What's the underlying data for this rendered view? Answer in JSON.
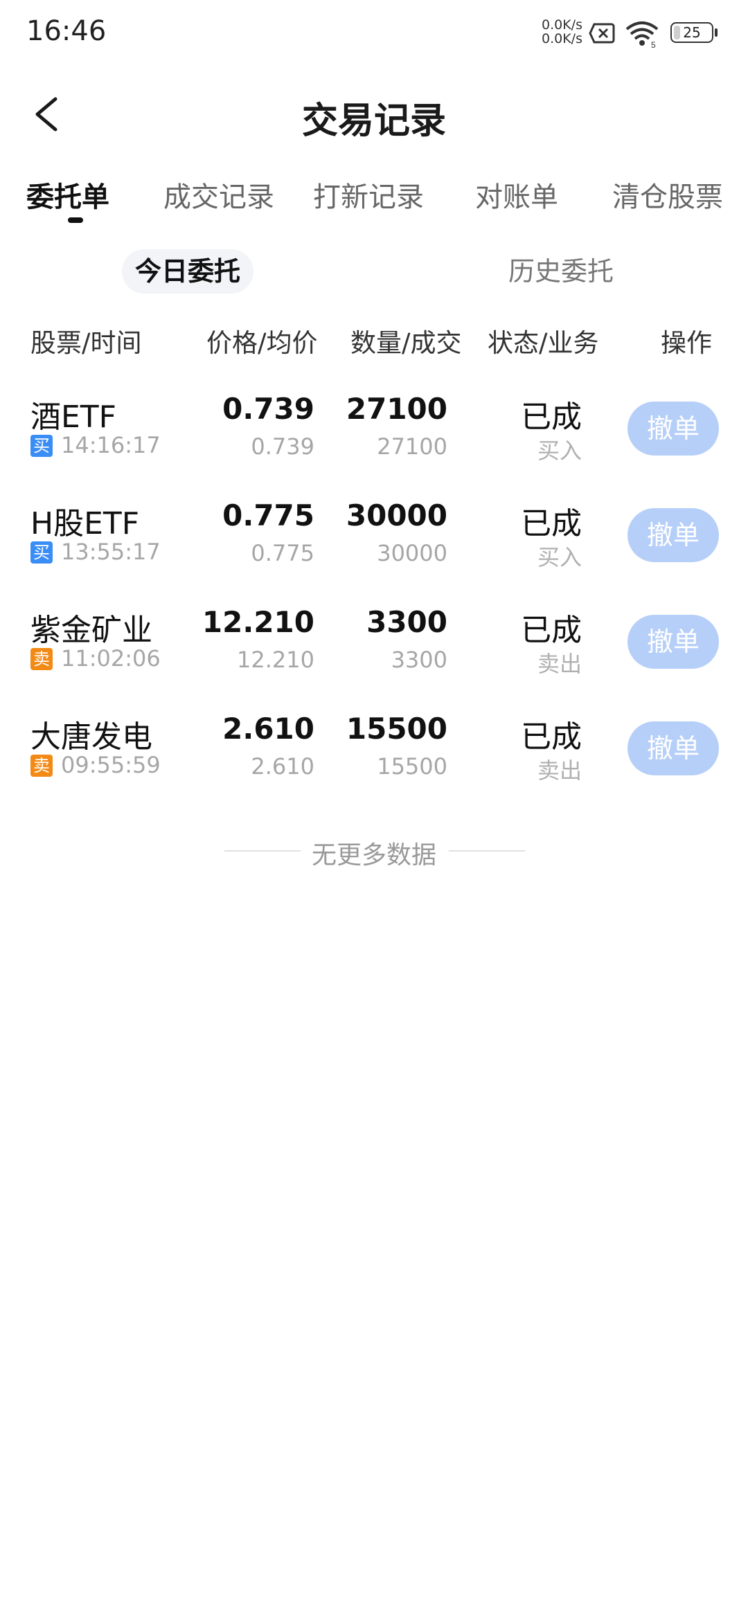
{
  "status_bar": {
    "time": "16:46",
    "net_speed_up": "0.0K/s",
    "net_speed_down": "0.0K/s",
    "wifi_label": "5",
    "battery": "25",
    "battery_level_pct": 25
  },
  "header": {
    "title": "交易记录"
  },
  "tabs": [
    {
      "label": "委托单",
      "active": true
    },
    {
      "label": "成交记录",
      "active": false
    },
    {
      "label": "打新记录",
      "active": false
    },
    {
      "label": "对账单",
      "active": false
    },
    {
      "label": "清仓股票",
      "active": false
    }
  ],
  "segment": {
    "today": "今日委托",
    "history": "历史委托"
  },
  "table": {
    "columns": [
      "股票/时间",
      "价格/均价",
      "数量/成交",
      "状态/业务",
      "操作"
    ],
    "rows": [
      {
        "name": "酒ETF",
        "tag": "买",
        "time": "14:16:17",
        "price": "0.739",
        "avg_price": "0.739",
        "qty": "27100",
        "filled": "27100",
        "status": "已成",
        "business": "买入",
        "action": "撤单"
      },
      {
        "name": "H股ETF",
        "tag": "买",
        "time": "13:55:17",
        "price": "0.775",
        "avg_price": "0.775",
        "qty": "30000",
        "filled": "30000",
        "status": "已成",
        "business": "买入",
        "action": "撤单"
      },
      {
        "name": "紫金矿业",
        "tag": "卖",
        "time": "11:02:06",
        "price": "12.210",
        "avg_price": "12.210",
        "qty": "3300",
        "filled": "3300",
        "status": "已成",
        "business": "卖出",
        "action": "撤单"
      },
      {
        "name": "大唐发电",
        "tag": "卖",
        "time": "09:55:59",
        "price": "2.610",
        "avg_price": "2.610",
        "qty": "15500",
        "filled": "15500",
        "status": "已成",
        "business": "卖出",
        "action": "撤单"
      }
    ]
  },
  "footer": {
    "no_more": "无更多数据"
  },
  "colors": {
    "buy_tag": "#3a8df5",
    "sell_tag": "#f38a16",
    "cancel_button_disabled": "#b6cff8"
  }
}
